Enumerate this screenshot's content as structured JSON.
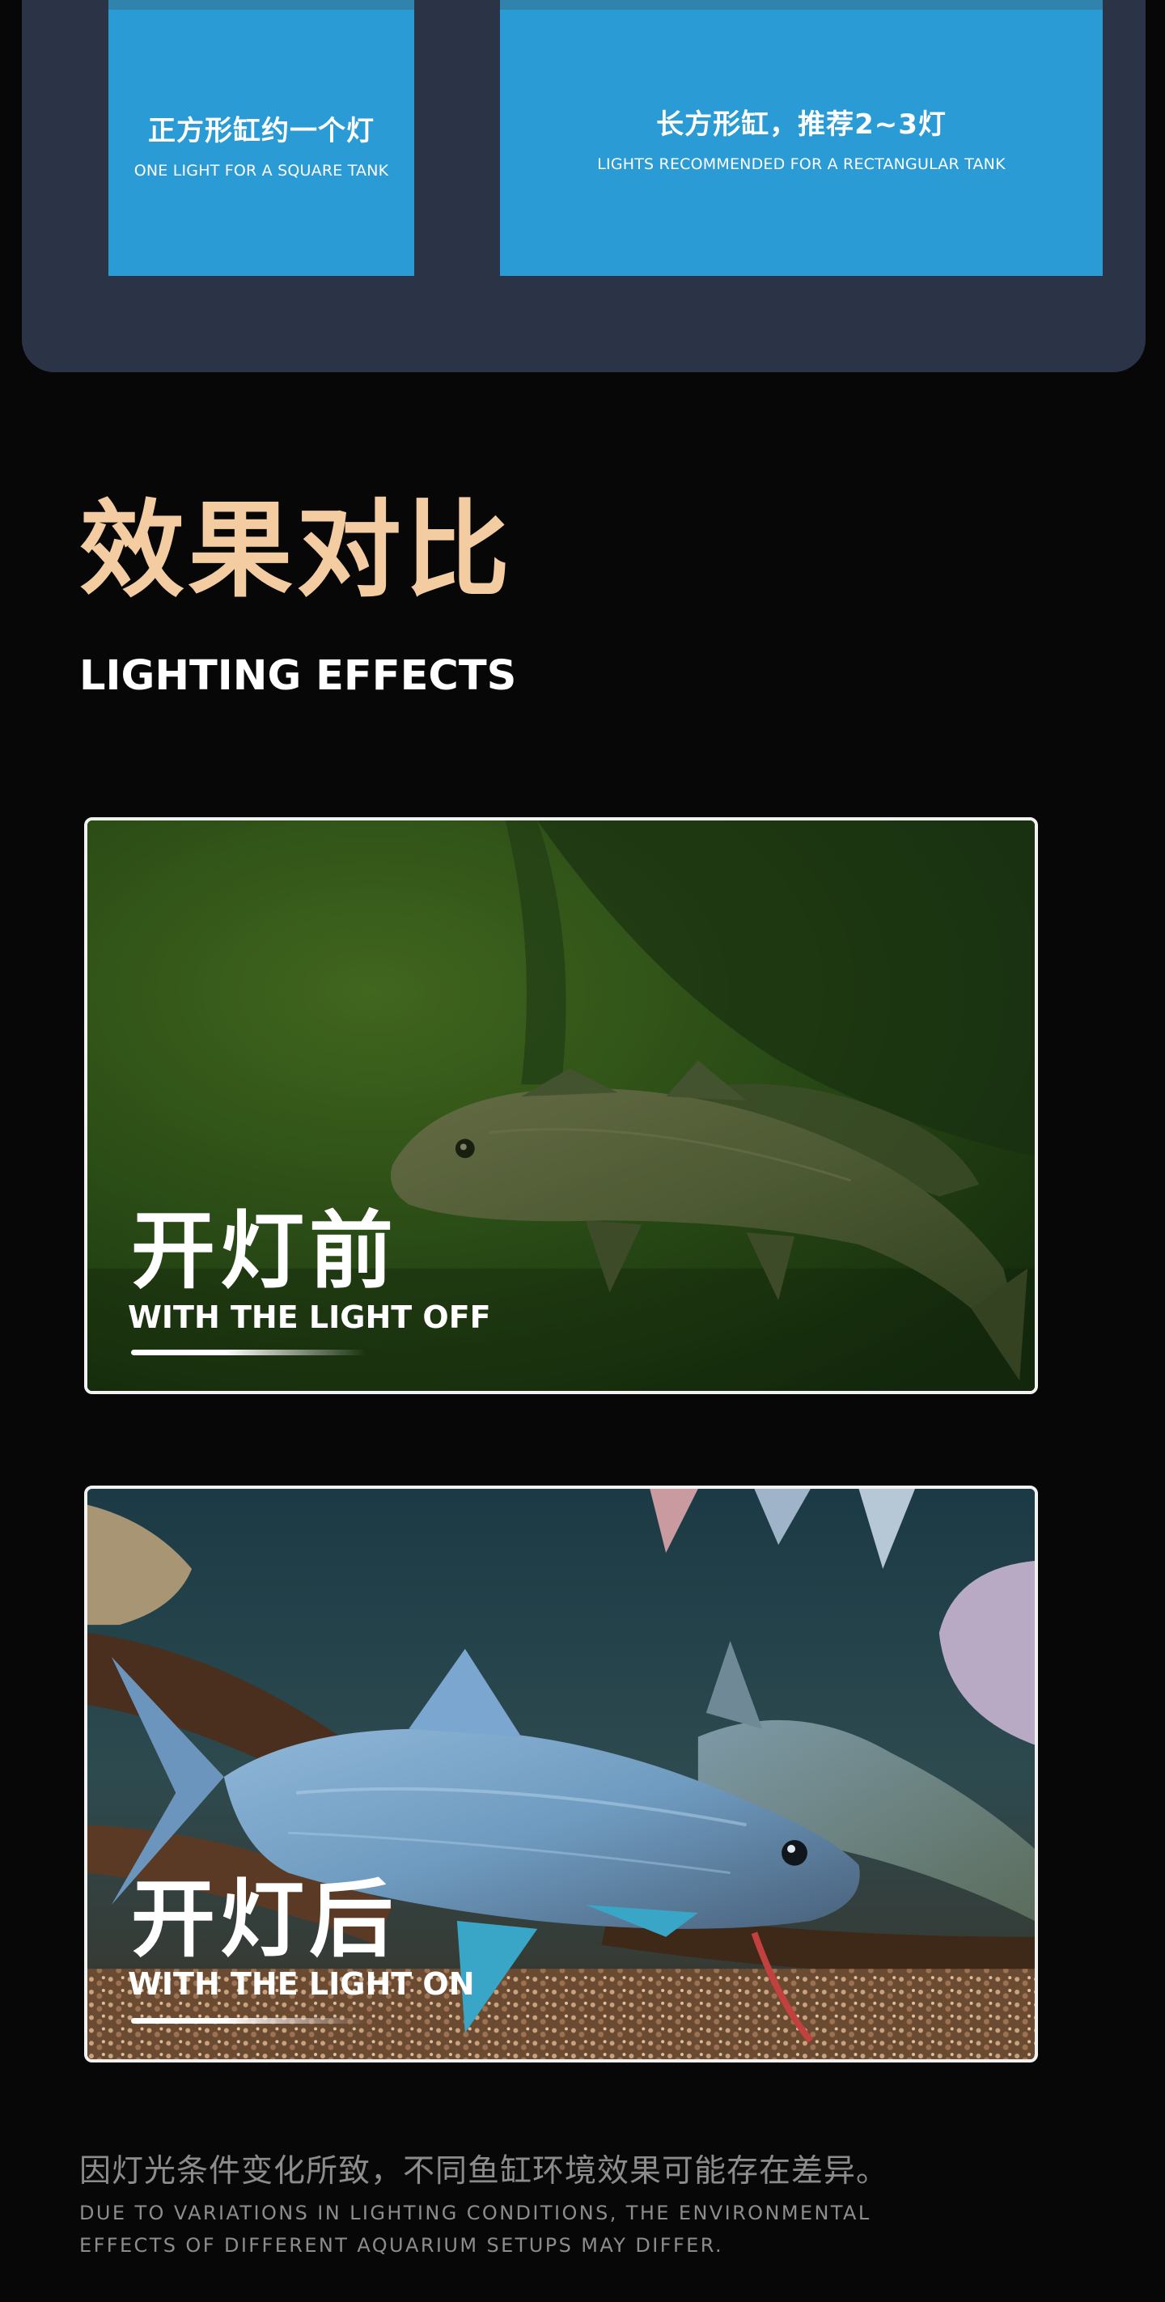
{
  "tank_guide": {
    "square": {
      "title": "正方形缸约一个灯",
      "subtitle": "ONE LIGHT FOR A SQUARE TANK"
    },
    "rectangular": {
      "title": "长方形缸，推荐2~3灯",
      "subtitle": "LIGHTS RECOMMENDED FOR A RECTANGULAR TANK"
    }
  },
  "section": {
    "title": "效果对比",
    "subtitle": "LIGHTING EFFECTS"
  },
  "comparison": {
    "before": {
      "label": "开灯前",
      "label_en": "WITH THE LIGHT OFF"
    },
    "after": {
      "label": "开灯后",
      "label_en": "WITH THE LIGHT ON"
    }
  },
  "disclaimer": {
    "cn": "因灯光条件变化所致，不同鱼缸环境效果可能存在差异。",
    "en": "DUE TO VARIATIONS IN LIGHTING CONDITIONS, THE ENVIRONMENTAL EFFECTS OF DIFFERENT AQUARIUM SETUPS MAY DIFFER."
  },
  "colors": {
    "page_background": "#070707",
    "panel_background": "#2b3447",
    "card_blue": "#2a9bd5",
    "heading_gold": "#f3cca2",
    "disclaimer_gray": "#8c8c8c"
  }
}
